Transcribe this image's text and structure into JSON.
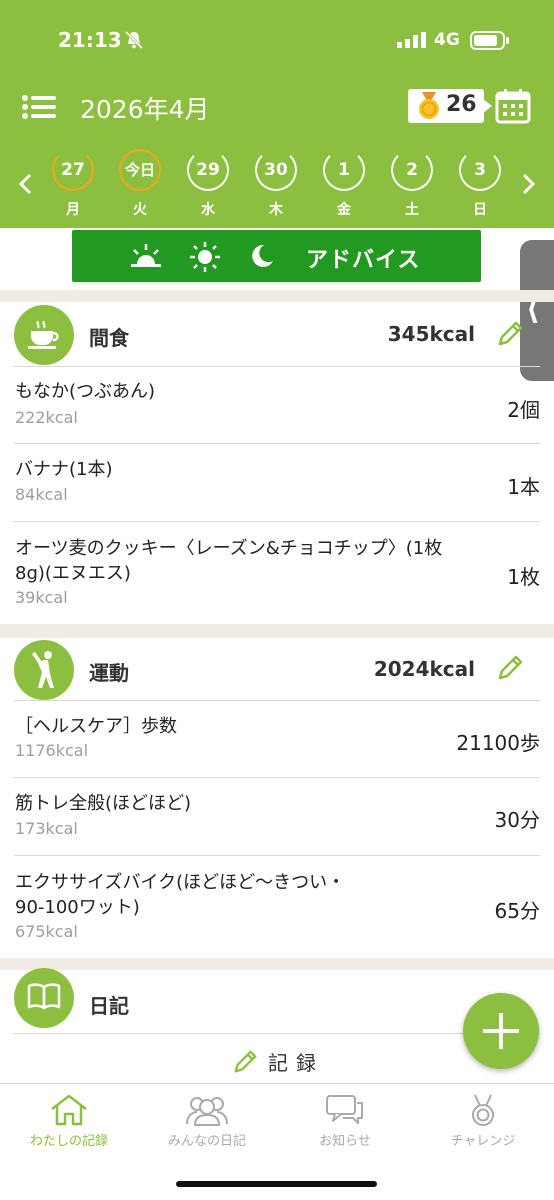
{
  "status": {
    "time": "21:13",
    "network": "4G"
  },
  "header": {
    "month_title": "2026年4月",
    "badge_count": "26"
  },
  "calendar": {
    "days": [
      {
        "num": "27",
        "weekday": "月"
      },
      {
        "num": "今日",
        "weekday": "火",
        "selected": true
      },
      {
        "num": "29",
        "weekday": "水"
      },
      {
        "num": "30",
        "weekday": "木"
      },
      {
        "num": "1",
        "weekday": "金"
      },
      {
        "num": "2",
        "weekday": "土"
      },
      {
        "num": "3",
        "weekday": "日"
      }
    ]
  },
  "advice": {
    "label": "アドバイス"
  },
  "snack": {
    "title": "間食",
    "kcal": "345kcal",
    "items": [
      {
        "name": "もなか(つぶあん)",
        "kcal": "222kcal",
        "qty": "2個"
      },
      {
        "name": "バナナ(1本)",
        "kcal": "84kcal",
        "qty": "1本"
      },
      {
        "name_line1": "オーツ麦のクッキー〈レーズン&チョコチップ〉(1枚",
        "name_line2": "8g)(エヌエス)",
        "kcal": "39kcal",
        "qty": "1枚"
      }
    ]
  },
  "exercise": {
    "title": "運動",
    "kcal": "2024kcal",
    "items": [
      {
        "name": "［ヘルスケア］歩数",
        "kcal": "1176kcal",
        "qty": "21100歩"
      },
      {
        "name": "筋トレ全般(ほどほど)",
        "kcal": "173kcal",
        "qty": "30分"
      },
      {
        "name_line1": "エクササイズバイク(ほどほど〜きつい・",
        "name_line2": "90-100ワット)",
        "kcal": "675kcal",
        "qty": "65分"
      }
    ]
  },
  "diary": {
    "title": "日記",
    "record_label": "記録"
  },
  "tabs": [
    {
      "label": "わたしの記録",
      "icon": "home-icon"
    },
    {
      "label": "みんなの日記",
      "icon": "people-icon"
    },
    {
      "label": "お知らせ",
      "icon": "chat-icon"
    },
    {
      "label": "チャレンジ",
      "icon": "medal-icon"
    }
  ],
  "colors": {
    "accent": "#8cbf3f",
    "advice": "#229a22",
    "today_ring": "#f2a81d"
  }
}
